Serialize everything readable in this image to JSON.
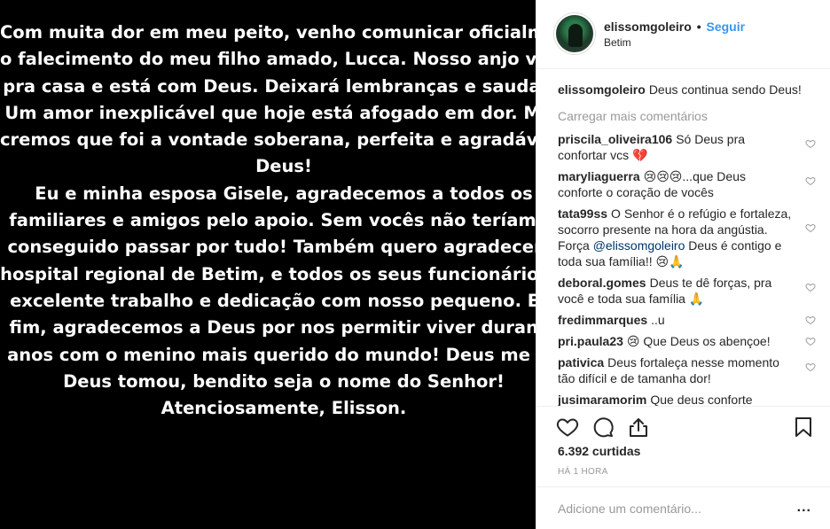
{
  "post_image": {
    "lines": [
      "Com muita dor em meu peito, venho comunicar oficialmen",
      "o falecimento do meu filho amado, Lucca. Nosso anjo volto",
      "pra casa e está com Deus. Deixará lembranças e saudade",
      "Um amor inexplicável que hoje está afogado em dor. Mas",
      "cremos que foi a vontade soberana, perfeita e agradável d",
      "Deus!",
      "Eu e minha esposa Gisele, agradecemos a todos os",
      "familiares e amigos pelo apoio. Sem vocês não teríamos",
      "conseguido passar por tudo! Também quero agradecer a",
      "hospital regional de Betim, e todos os seus funcionários p",
      "excelente trabalho e dedicação com nosso pequeno. E p",
      "fim, agradecemos a Deus por nos permitir viver durante",
      "anos com o menino mais querido do mundo! Deus me de",
      "Deus tomou, bendito seja o nome do Senhor!",
      "Atenciosamente, Elisson."
    ]
  },
  "header": {
    "username": "elissomgoleiro",
    "dot": "•",
    "follow_label": "Seguir",
    "location": "Betim"
  },
  "caption": {
    "username": "elissomgoleiro",
    "text": "Deus continua sendo Deus!"
  },
  "load_more_label": "Carregar mais comentários",
  "comments": [
    {
      "username": "priscila_oliveira106",
      "text": "Só Deus pra confortar vcs 💔"
    },
    {
      "username": "maryliaguerra",
      "text": "😢😢😢...que Deus conforte o coração de vocês"
    },
    {
      "username": "tata99ss",
      "text_before": "O Senhor é o refúgio e fortaleza, socorro presente na hora da angústia. Força ",
      "mention": "@elissomgoleiro",
      "text_after": " Deus é contigo e toda sua família!! 😢🙏"
    },
    {
      "username": "deboral.gomes",
      "text": "Deus te dê forças, pra você e toda sua família 🙏"
    },
    {
      "username": "fredimmarques",
      "text": "..u"
    },
    {
      "username": "pri.paula23",
      "text": "😢 Que Deus os abençoe!"
    },
    {
      "username": "pativica",
      "text": "Deus fortaleça nesse momento tão difícil e de tamanha dor!"
    },
    {
      "username": "jusimaramorim",
      "text": "Que deus conforte"
    }
  ],
  "actions": {
    "like_icon": "heart-icon",
    "comment_icon": "comment-icon",
    "share_icon": "share-icon",
    "save_icon": "bookmark-icon"
  },
  "likes_label": "6.392 curtidas",
  "time_label": "HÁ 1 HORA",
  "add_comment": {
    "placeholder": "Adicione um comentário...",
    "more_label": "..."
  },
  "colors": {
    "follow": "#3897f0",
    "muted": "#999999",
    "text": "#262626",
    "image_bg": "#000000"
  }
}
